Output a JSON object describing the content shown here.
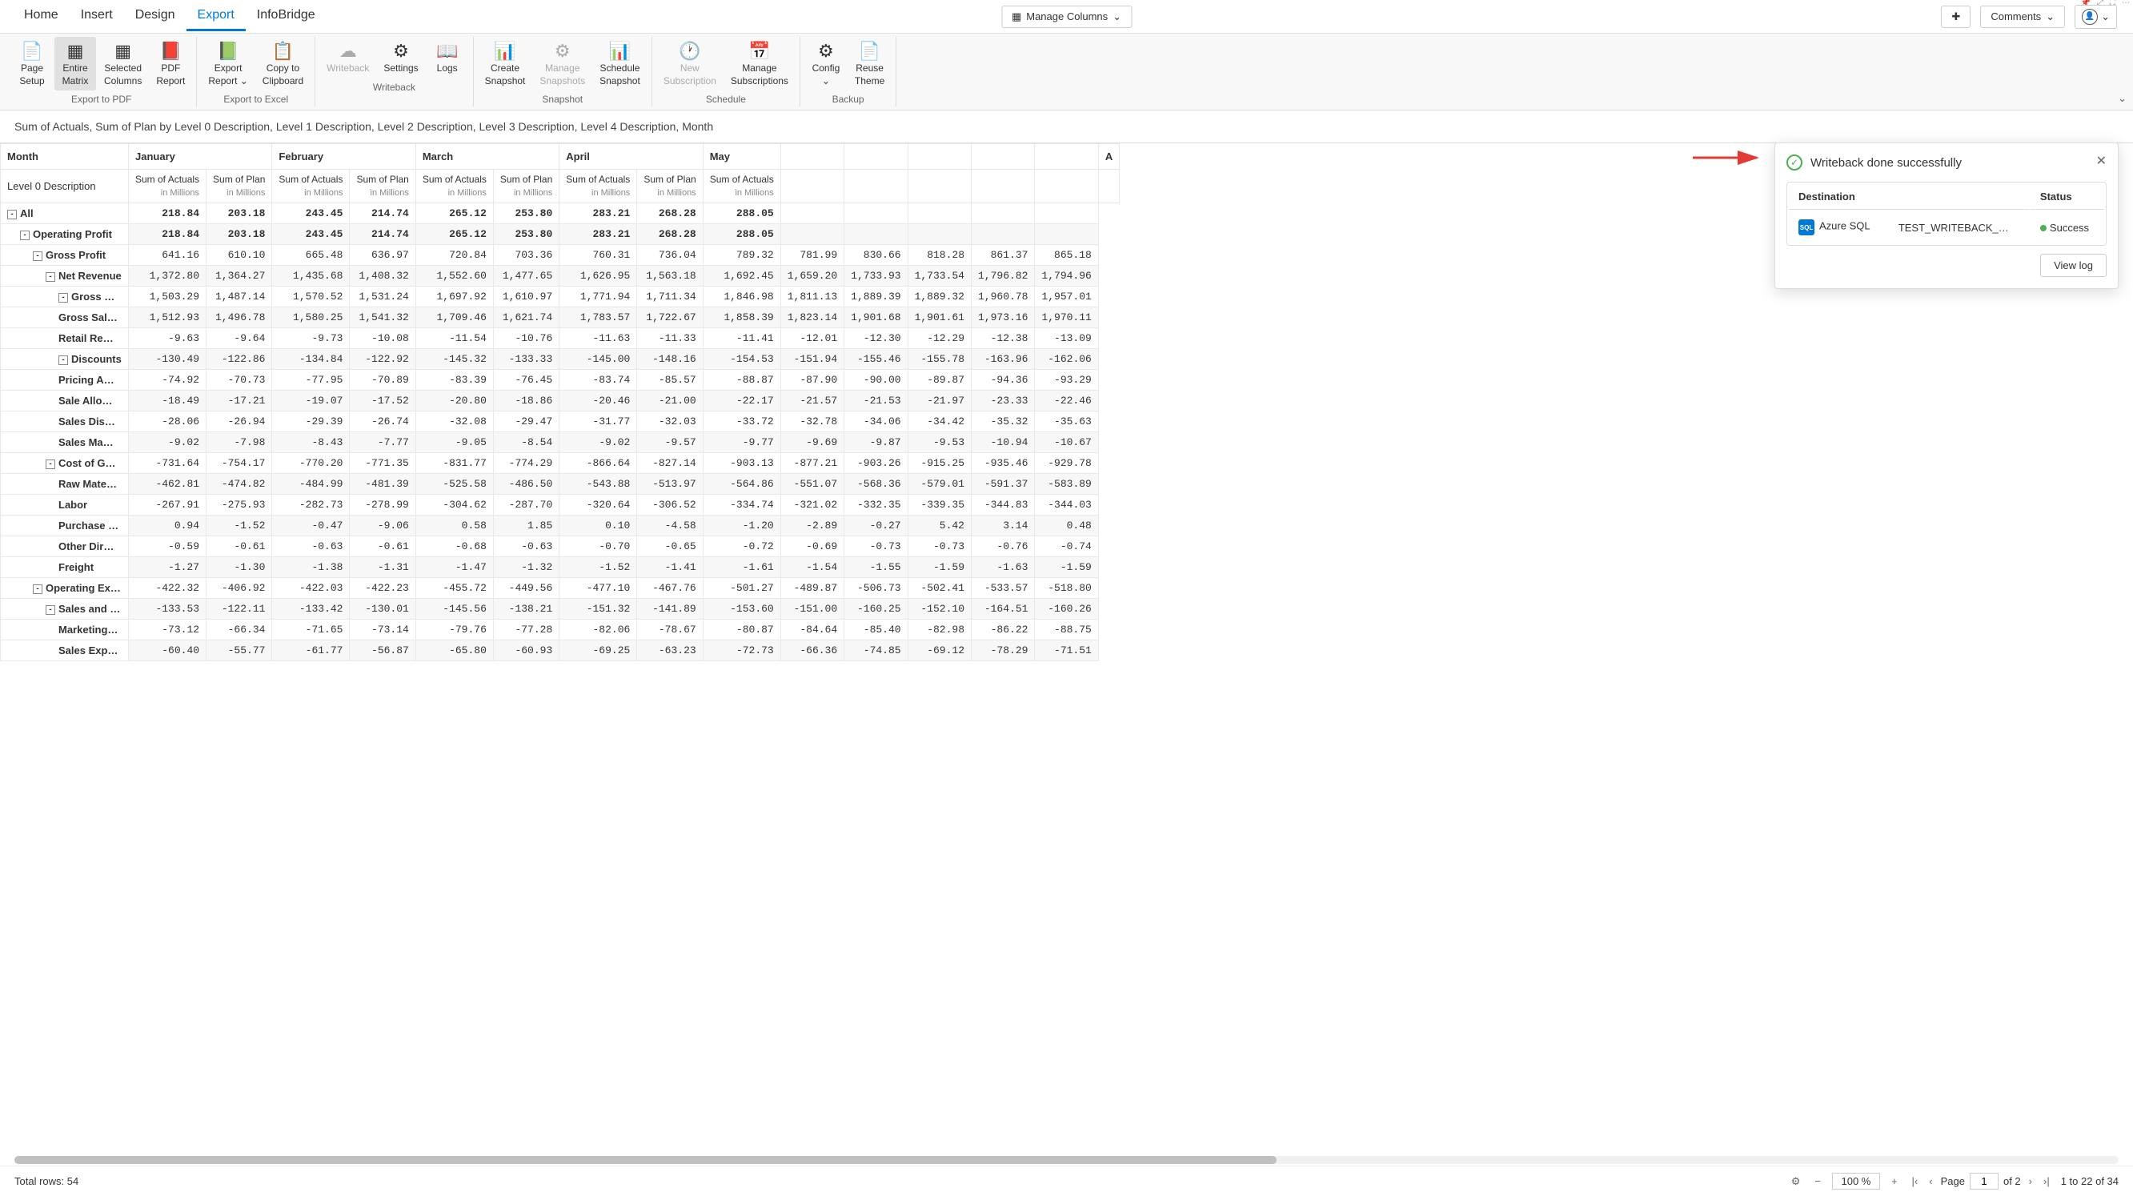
{
  "tabs": [
    "Home",
    "Insert",
    "Design",
    "Export",
    "InfoBridge"
  ],
  "active_tab": 3,
  "manage_columns": "Manage Columns",
  "comments": "Comments",
  "ribbon_groups": [
    {
      "label": "Export to PDF",
      "buttons": [
        {
          "id": "page-setup",
          "icon": "📄",
          "l1": "Page",
          "l2": "Setup"
        },
        {
          "id": "entire-matrix",
          "icon": "▦",
          "l1": "Entire",
          "l2": "Matrix",
          "selected": true
        },
        {
          "id": "selected-columns",
          "icon": "▦",
          "l1": "Selected",
          "l2": "Columns"
        },
        {
          "id": "pdf-report",
          "icon": "📕",
          "l1": "PDF",
          "l2": "Report"
        }
      ]
    },
    {
      "label": "Export to Excel",
      "buttons": [
        {
          "id": "export-report",
          "icon": "📗",
          "l1": "Export",
          "l2": "Report ⌄"
        },
        {
          "id": "copy-clipboard",
          "icon": "📋",
          "l1": "Copy to",
          "l2": "Clipboard"
        }
      ]
    },
    {
      "label": "Writeback",
      "buttons": [
        {
          "id": "writeback",
          "icon": "☁",
          "l1": "Writeback",
          "l2": "",
          "disabled": true
        },
        {
          "id": "settings",
          "icon": "⚙",
          "l1": "Settings",
          "l2": ""
        },
        {
          "id": "logs",
          "icon": "📖",
          "l1": "Logs",
          "l2": ""
        }
      ]
    },
    {
      "label": "Snapshot",
      "buttons": [
        {
          "id": "create-snapshot",
          "icon": "📊",
          "l1": "Create",
          "l2": "Snapshot"
        },
        {
          "id": "manage-snapshots",
          "icon": "⚙",
          "l1": "Manage",
          "l2": "Snapshots",
          "disabled": true
        },
        {
          "id": "schedule-snapshot",
          "icon": "📊",
          "l1": "Schedule",
          "l2": "Snapshot"
        }
      ]
    },
    {
      "label": "Schedule",
      "buttons": [
        {
          "id": "new-subscription",
          "icon": "🕐",
          "l1": "New",
          "l2": "Subscription",
          "disabled": true
        },
        {
          "id": "manage-subscriptions",
          "icon": "📅",
          "l1": "Manage",
          "l2": "Subscriptions"
        }
      ]
    },
    {
      "label": "Backup",
      "buttons": [
        {
          "id": "config",
          "icon": "⚙",
          "l1": "Config",
          "l2": "⌄"
        },
        {
          "id": "reuse-theme",
          "icon": "📄",
          "l1": "Reuse",
          "l2": "Theme"
        }
      ]
    }
  ],
  "subtitle": "Sum of Actuals, Sum of Plan by Level 0 Description, Level 1 Description, Level 2 Description, Level 3 Description, Level 4 Description, Month",
  "matrix": {
    "corner1": "Month",
    "corner2": "Level 0 Description",
    "months": [
      "January",
      "February",
      "March",
      "April",
      "May",
      "",
      "",
      "",
      "",
      "",
      "",
      "",
      "",
      ""
    ],
    "col_main": "Sum of Actuals",
    "col_alt": "Sum of Plan",
    "col_sub": "in Millions",
    "last_month_partial": "A",
    "rows": [
      {
        "label": "All",
        "indent": 0,
        "bold": true,
        "toggle": "-",
        "v": [
          "218.84",
          "203.18",
          "243.45",
          "214.74",
          "265.12",
          "253.80",
          "283.21",
          "268.28",
          "288.05",
          "",
          "",
          "",
          "",
          "",
          "",
          "",
          "",
          "",
          "",
          "",
          "",
          "",
          "",
          "",
          "",
          "",
          ""
        ]
      },
      {
        "label": "Operating Profit",
        "indent": 1,
        "bold": true,
        "toggle": "-",
        "v": [
          "218.84",
          "203.18",
          "243.45",
          "214.74",
          "265.12",
          "253.80",
          "283.21",
          "268.28",
          "288.05",
          "",
          "",
          "",
          "",
          "",
          "",
          "",
          "",
          "",
          "",
          "",
          "",
          "",
          "",
          "",
          "",
          "",
          ""
        ]
      },
      {
        "label": "Gross Profit",
        "indent": 2,
        "toggle": "-",
        "v": [
          "641.16",
          "610.10",
          "665.48",
          "636.97",
          "720.84",
          "703.36",
          "760.31",
          "736.04",
          "789.32",
          "781.99",
          "830.66",
          "818.28",
          "861.37",
          "865.18"
        ]
      },
      {
        "label": "Net Revenue",
        "indent": 3,
        "toggle": "-",
        "v": [
          "1,372.80",
          "1,364.27",
          "1,435.68",
          "1,408.32",
          "1,552.60",
          "1,477.65",
          "1,626.95",
          "1,563.18",
          "1,692.45",
          "1,659.20",
          "1,733.93",
          "1,733.54",
          "1,796.82",
          "1,794.96"
        ]
      },
      {
        "label": "Gross Rev…",
        "indent": 4,
        "toggle": "-",
        "v": [
          "1,503.29",
          "1,487.14",
          "1,570.52",
          "1,531.24",
          "1,697.92",
          "1,610.97",
          "1,771.94",
          "1,711.34",
          "1,846.98",
          "1,811.13",
          "1,889.39",
          "1,889.32",
          "1,960.78",
          "1,957.01"
        ]
      },
      {
        "label": "Gross Sal…",
        "indent": 5,
        "v": [
          "1,512.93",
          "1,496.78",
          "1,580.25",
          "1,541.32",
          "1,709.46",
          "1,621.74",
          "1,783.57",
          "1,722.67",
          "1,858.39",
          "1,823.14",
          "1,901.68",
          "1,901.61",
          "1,973.16",
          "1,970.11"
        ]
      },
      {
        "label": "Retail Re…",
        "indent": 5,
        "v": [
          "-9.63",
          "-9.64",
          "-9.73",
          "-10.08",
          "-11.54",
          "-10.76",
          "-11.63",
          "-11.33",
          "-11.41",
          "-12.01",
          "-12.30",
          "-12.29",
          "-12.38",
          "-13.09"
        ]
      },
      {
        "label": "Discounts",
        "indent": 4,
        "toggle": "-",
        "v": [
          "-130.49",
          "-122.86",
          "-134.84",
          "-122.92",
          "-145.32",
          "-133.33",
          "-145.00",
          "-148.16",
          "-154.53",
          "-151.94",
          "-155.46",
          "-155.78",
          "-163.96",
          "-162.06"
        ]
      },
      {
        "label": "Pricing A…",
        "indent": 5,
        "v": [
          "-74.92",
          "-70.73",
          "-77.95",
          "-70.89",
          "-83.39",
          "-76.45",
          "-83.74",
          "-85.57",
          "-88.87",
          "-87.90",
          "-90.00",
          "-89.87",
          "-94.36",
          "-93.29"
        ]
      },
      {
        "label": "Sale Allo…",
        "indent": 5,
        "v": [
          "-18.49",
          "-17.21",
          "-19.07",
          "-17.52",
          "-20.80",
          "-18.86",
          "-20.46",
          "-21.00",
          "-22.17",
          "-21.57",
          "-21.53",
          "-21.97",
          "-23.33",
          "-22.46"
        ]
      },
      {
        "label": "Sales Dis…",
        "indent": 5,
        "v": [
          "-28.06",
          "-26.94",
          "-29.39",
          "-26.74",
          "-32.08",
          "-29.47",
          "-31.77",
          "-32.03",
          "-33.72",
          "-32.78",
          "-34.06",
          "-34.42",
          "-35.32",
          "-35.63"
        ]
      },
      {
        "label": "Sales Ma…",
        "indent": 5,
        "v": [
          "-9.02",
          "-7.98",
          "-8.43",
          "-7.77",
          "-9.05",
          "-8.54",
          "-9.02",
          "-9.57",
          "-9.77",
          "-9.69",
          "-9.87",
          "-9.53",
          "-10.94",
          "-10.67"
        ]
      },
      {
        "label": "Cost of Goo…",
        "indent": 3,
        "toggle": "-",
        "v": [
          "-731.64",
          "-754.17",
          "-770.20",
          "-771.35",
          "-831.77",
          "-774.29",
          "-866.64",
          "-827.14",
          "-903.13",
          "-877.21",
          "-903.26",
          "-915.25",
          "-935.46",
          "-929.78"
        ]
      },
      {
        "label": "Raw Mate…",
        "indent": 4,
        "v": [
          "-462.81",
          "-474.82",
          "-484.99",
          "-481.39",
          "-525.58",
          "-486.50",
          "-543.88",
          "-513.97",
          "-564.86",
          "-551.07",
          "-568.36",
          "-579.01",
          "-591.37",
          "-583.89"
        ]
      },
      {
        "label": "Labor",
        "indent": 4,
        "v": [
          "-267.91",
          "-275.93",
          "-282.73",
          "-278.99",
          "-304.62",
          "-287.70",
          "-320.64",
          "-306.52",
          "-334.74",
          "-321.02",
          "-332.35",
          "-339.35",
          "-344.83",
          "-344.03"
        ]
      },
      {
        "label": "Purchase …",
        "indent": 4,
        "v": [
          "0.94",
          "-1.52",
          "-0.47",
          "-9.06",
          "0.58",
          "1.85",
          "0.10",
          "-4.58",
          "-1.20",
          "-2.89",
          "-0.27",
          "5.42",
          "3.14",
          "0.48"
        ]
      },
      {
        "label": "Other Dir…",
        "indent": 4,
        "v": [
          "-0.59",
          "-0.61",
          "-0.63",
          "-0.61",
          "-0.68",
          "-0.63",
          "-0.70",
          "-0.65",
          "-0.72",
          "-0.69",
          "-0.73",
          "-0.73",
          "-0.76",
          "-0.74"
        ]
      },
      {
        "label": "Freight",
        "indent": 4,
        "v": [
          "-1.27",
          "-1.30",
          "-1.38",
          "-1.31",
          "-1.47",
          "-1.32",
          "-1.52",
          "-1.41",
          "-1.61",
          "-1.54",
          "-1.55",
          "-1.59",
          "-1.63",
          "-1.59"
        ]
      },
      {
        "label": "Operating Ex…",
        "indent": 2,
        "toggle": "-",
        "v": [
          "-422.32",
          "-406.92",
          "-422.03",
          "-422.23",
          "-455.72",
          "-449.56",
          "-477.10",
          "-467.76",
          "-501.27",
          "-489.87",
          "-506.73",
          "-502.41",
          "-533.57",
          "-518.80"
        ]
      },
      {
        "label": "Sales and M…",
        "indent": 3,
        "toggle": "-",
        "v": [
          "-133.53",
          "-122.11",
          "-133.42",
          "-130.01",
          "-145.56",
          "-138.21",
          "-151.32",
          "-141.89",
          "-153.60",
          "-151.00",
          "-160.25",
          "-152.10",
          "-164.51",
          "-160.26"
        ]
      },
      {
        "label": "Marketing…",
        "indent": 4,
        "v": [
          "-73.12",
          "-66.34",
          "-71.65",
          "-73.14",
          "-79.76",
          "-77.28",
          "-82.06",
          "-78.67",
          "-80.87",
          "-84.64",
          "-85.40",
          "-82.98",
          "-86.22",
          "-88.75"
        ]
      },
      {
        "label": "Sales Exp…",
        "indent": 4,
        "v": [
          "-60.40",
          "-55.77",
          "-61.77",
          "-56.87",
          "-65.80",
          "-60.93",
          "-69.25",
          "-63.23",
          "-72.73",
          "-66.36",
          "-74.85",
          "-69.12",
          "-78.29",
          "-71.51"
        ]
      }
    ]
  },
  "toast": {
    "title": "Writeback done successfully",
    "th_dest": "Destination",
    "th_status": "Status",
    "dest_type": "Azure SQL",
    "dest_name": "TEST_WRITEBACK_…",
    "status": "Success",
    "status_color": "#4caf50",
    "view_log": "View log"
  },
  "footer": {
    "total": "Total rows: 54",
    "zoom": "100 %",
    "page_label": "Page",
    "page_val": "1",
    "page_of": "of 2",
    "rows": "1 to 22 of 34"
  }
}
